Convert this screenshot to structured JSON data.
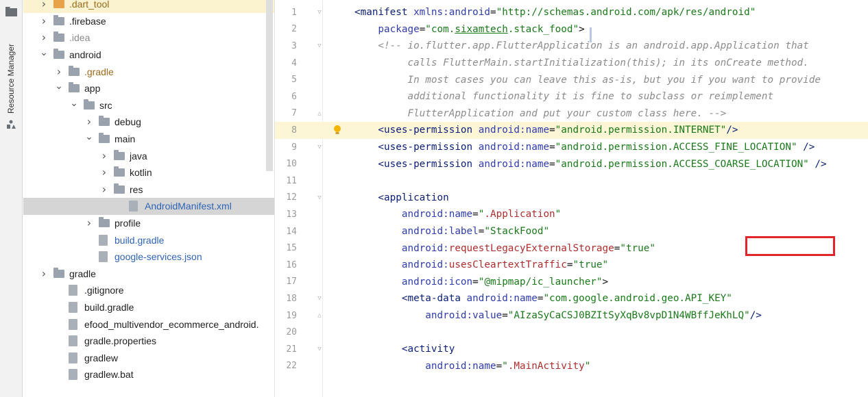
{
  "toolwindow": {
    "side_label": "Resource Manager"
  },
  "tree": [
    {
      "indent": 1,
      "arrow": "right",
      "icon": "folder-orange",
      "label": ".dart_tool",
      "style": "orange",
      "bg": "highlight"
    },
    {
      "indent": 1,
      "arrow": "right",
      "icon": "folder",
      "label": ".firebase",
      "style": "normal"
    },
    {
      "indent": 1,
      "arrow": "right",
      "icon": "folder",
      "label": ".idea",
      "style": "muted"
    },
    {
      "indent": 1,
      "arrow": "down",
      "icon": "folder",
      "label": "android",
      "style": "normal"
    },
    {
      "indent": 2,
      "arrow": "right",
      "icon": "folder",
      "label": ".gradle",
      "style": "orange"
    },
    {
      "indent": 2,
      "arrow": "down",
      "icon": "folder",
      "label": "app",
      "style": "normal"
    },
    {
      "indent": 3,
      "arrow": "down",
      "icon": "folder",
      "label": "src",
      "style": "normal"
    },
    {
      "indent": 4,
      "arrow": "right",
      "icon": "folder",
      "label": "debug",
      "style": "normal"
    },
    {
      "indent": 4,
      "arrow": "down",
      "icon": "folder",
      "label": "main",
      "style": "normal"
    },
    {
      "indent": 5,
      "arrow": "right",
      "icon": "folder",
      "label": "java",
      "style": "normal"
    },
    {
      "indent": 5,
      "arrow": "right",
      "icon": "folder",
      "label": "kotlin",
      "style": "normal"
    },
    {
      "indent": 5,
      "arrow": "right",
      "icon": "folder",
      "label": "res",
      "style": "normal"
    },
    {
      "indent": 6,
      "arrow": "none",
      "icon": "file",
      "label": "AndroidManifest.xml",
      "style": "link",
      "bg": "selected"
    },
    {
      "indent": 4,
      "arrow": "right",
      "icon": "folder",
      "label": "profile",
      "style": "normal"
    },
    {
      "indent": 4,
      "arrow": "none",
      "icon": "file",
      "label": "build.gradle",
      "style": "link"
    },
    {
      "indent": 4,
      "arrow": "none",
      "icon": "file",
      "label": "google-services.json",
      "style": "link"
    },
    {
      "indent": 1,
      "arrow": "right",
      "icon": "folder",
      "label": "gradle",
      "style": "normal"
    },
    {
      "indent": 2,
      "arrow": "none",
      "icon": "file",
      "label": ".gitignore",
      "style": "normal"
    },
    {
      "indent": 2,
      "arrow": "none",
      "icon": "file",
      "label": "build.gradle",
      "style": "normal"
    },
    {
      "indent": 2,
      "arrow": "none",
      "icon": "file",
      "label": "efood_multivendor_ecommerce_android.",
      "style": "normal"
    },
    {
      "indent": 2,
      "arrow": "none",
      "icon": "file",
      "label": "gradle.properties",
      "style": "normal"
    },
    {
      "indent": 2,
      "arrow": "none",
      "icon": "file",
      "label": "gradlew",
      "style": "normal"
    },
    {
      "indent": 2,
      "arrow": "none",
      "icon": "file",
      "label": "gradlew.bat",
      "style": "normal"
    }
  ],
  "editor": {
    "lines": [
      {
        "n": "1",
        "segs": [
          [
            "tag",
            "<manifest "
          ],
          [
            "attr",
            "xmlns:android"
          ],
          [
            "dark",
            "="
          ],
          [
            "str",
            "\"http://schemas.android.com/apk/res/android\""
          ]
        ]
      },
      {
        "n": "2",
        "segs": [
          [
            "attr",
            "    package"
          ],
          [
            "dark",
            "="
          ],
          [
            "str",
            "\"com."
          ],
          [
            "strU",
            "sixamtech"
          ],
          [
            "str",
            ".stack_food\""
          ],
          [
            "dark",
            ">"
          ]
        ]
      },
      {
        "n": "3",
        "segs": [
          [
            "comment",
            "    <!-- io.flutter.app.FlutterApplication is an android.app.Application that"
          ]
        ]
      },
      {
        "n": "4",
        "segs": [
          [
            "comment",
            "         calls FlutterMain.startInitialization(this); in its onCreate method."
          ]
        ]
      },
      {
        "n": "5",
        "segs": [
          [
            "comment",
            "         In most cases you can leave this as-is, but you if you want to provide"
          ]
        ]
      },
      {
        "n": "6",
        "segs": [
          [
            "comment",
            "         additional functionality it is fine to subclass or reimplement"
          ]
        ]
      },
      {
        "n": "7",
        "segs": [
          [
            "comment",
            "         FlutterApplication and put your custom class here. -->"
          ]
        ]
      },
      {
        "n": "8",
        "segs": [
          [
            "tag",
            "    <uses-permission "
          ],
          [
            "attr",
            "android:name"
          ],
          [
            "dark",
            "="
          ],
          [
            "str",
            "\"android.permission.INTERNET\""
          ],
          [
            "tag",
            "/>"
          ]
        ]
      },
      {
        "n": "9",
        "segs": [
          [
            "tag",
            "    <uses-permission "
          ],
          [
            "attr",
            "android:name"
          ],
          [
            "dark",
            "="
          ],
          [
            "str",
            "\"android.permission.ACCESS_FINE_LOCATION\""
          ],
          [
            "tag",
            " />"
          ]
        ]
      },
      {
        "n": "10",
        "segs": [
          [
            "tag",
            "    <uses-permission "
          ],
          [
            "attr",
            "android:name"
          ],
          [
            "dark",
            "="
          ],
          [
            "str",
            "\"android.permission.ACCESS_COARSE_LOCATION\""
          ],
          [
            "tag",
            " />"
          ]
        ]
      },
      {
        "n": "11",
        "segs": []
      },
      {
        "n": "12",
        "segs": [
          [
            "tag",
            "    <application"
          ]
        ]
      },
      {
        "n": "13",
        "segs": [
          [
            "attr",
            "        android:name"
          ],
          [
            "dark",
            "="
          ],
          [
            "str",
            "\""
          ],
          [
            "red",
            ".Application"
          ],
          [
            "str",
            "\""
          ]
        ]
      },
      {
        "n": "14",
        "segs": [
          [
            "attr",
            "        android:label"
          ],
          [
            "dark",
            "="
          ],
          [
            "str",
            "\"StackFood\""
          ]
        ]
      },
      {
        "n": "15",
        "segs": [
          [
            "attr",
            "        android:"
          ],
          [
            "red",
            "requestLegacyExternalStorage"
          ],
          [
            "dark",
            "="
          ],
          [
            "str",
            "\"true\""
          ]
        ]
      },
      {
        "n": "16",
        "segs": [
          [
            "attr",
            "        android:"
          ],
          [
            "red",
            "usesCleartextTraffic"
          ],
          [
            "dark",
            "="
          ],
          [
            "str",
            "\"true\""
          ]
        ]
      },
      {
        "n": "17",
        "segs": [
          [
            "attr",
            "        android:icon"
          ],
          [
            "dark",
            "="
          ],
          [
            "str",
            "\"@mipmap/ic_launcher\""
          ],
          [
            "dark",
            ">"
          ]
        ]
      },
      {
        "n": "18",
        "segs": [
          [
            "tag",
            "        <meta-data "
          ],
          [
            "attr",
            "android:name"
          ],
          [
            "dark",
            "="
          ],
          [
            "str",
            "\"com.google.android.geo.API_KEY\""
          ]
        ]
      },
      {
        "n": "19",
        "segs": [
          [
            "attr",
            "            android:value"
          ],
          [
            "dark",
            "="
          ],
          [
            "str",
            "\"AIzaSyCaCSJ0BZItSyXqBv8vpD1N4WBffJeKhLQ\""
          ],
          [
            "tag",
            "/>"
          ]
        ]
      },
      {
        "n": "20",
        "segs": []
      },
      {
        "n": "21",
        "segs": [
          [
            "tag",
            "        <activity"
          ]
        ]
      },
      {
        "n": "22",
        "segs": [
          [
            "attr",
            "            android:name"
          ],
          [
            "dark",
            "="
          ],
          [
            "str",
            "\""
          ],
          [
            "red",
            ".MainActivity"
          ],
          [
            "str",
            "\""
          ]
        ]
      }
    ]
  },
  "colors": {
    "highlight_box": "#e0252b",
    "current_line": "#fcf5d6"
  }
}
